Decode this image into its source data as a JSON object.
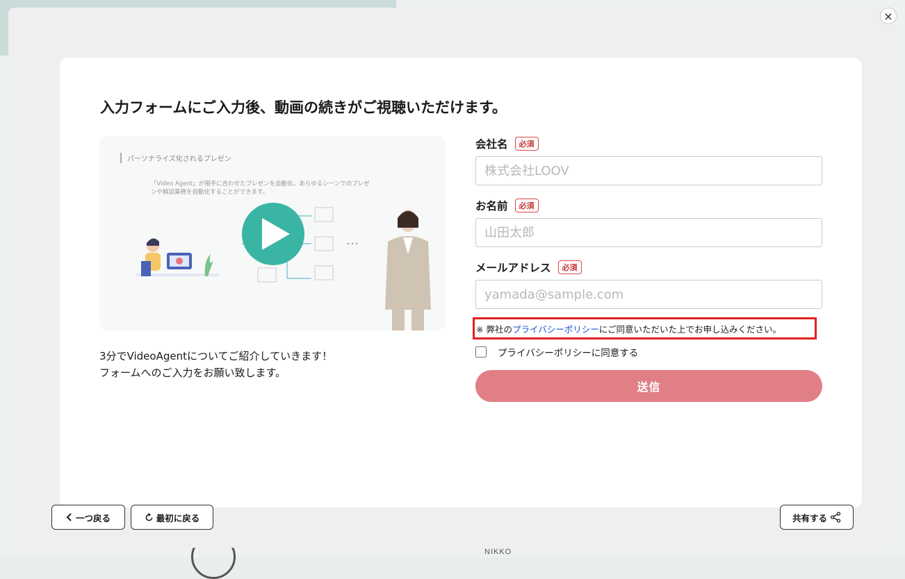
{
  "background": {
    "logo_nikko": "NIKKO"
  },
  "modal": {
    "close_label": "×",
    "heading": "入力フォームにご入力後、動画の続きがご視聴いただけます。",
    "video": {
      "slide_title": "パーソナライズ化されるプレゼン",
      "slide_desc": "「Video Agent」が相手に合わせたプレゼンを自動化。あらゆるシーンでのプレゼンや解説業務を自動化することができます。",
      "play_icon": "play-icon",
      "accent_color": "#3ab5a4"
    },
    "intro_lines": [
      "3分でVideoAgentについてご紹介していきます！",
      "フォームへのご入力をお願い致します。"
    ],
    "form": {
      "required_badge": "必須",
      "company": {
        "label": "会社名",
        "placeholder": "株式会社LOOV",
        "value": ""
      },
      "name": {
        "label": "お名前",
        "placeholder": "山田太郎",
        "value": ""
      },
      "email": {
        "label": "メールアドレス",
        "placeholder": "yamada@sample.com",
        "value": ""
      },
      "privacy_note": {
        "prefix": "※ 弊社の",
        "link": "プライバシーポリシー",
        "suffix": "にご同意いただいた上でお申し込みください。"
      },
      "agree_label": "プライバシーポリシーに同意する",
      "agree_checked": false,
      "submit_label": "送信",
      "submit_color": "#e17f87"
    },
    "footer": {
      "back_label": "一つ戻る",
      "restart_label": "最初に戻る",
      "share_label": "共有する"
    }
  }
}
